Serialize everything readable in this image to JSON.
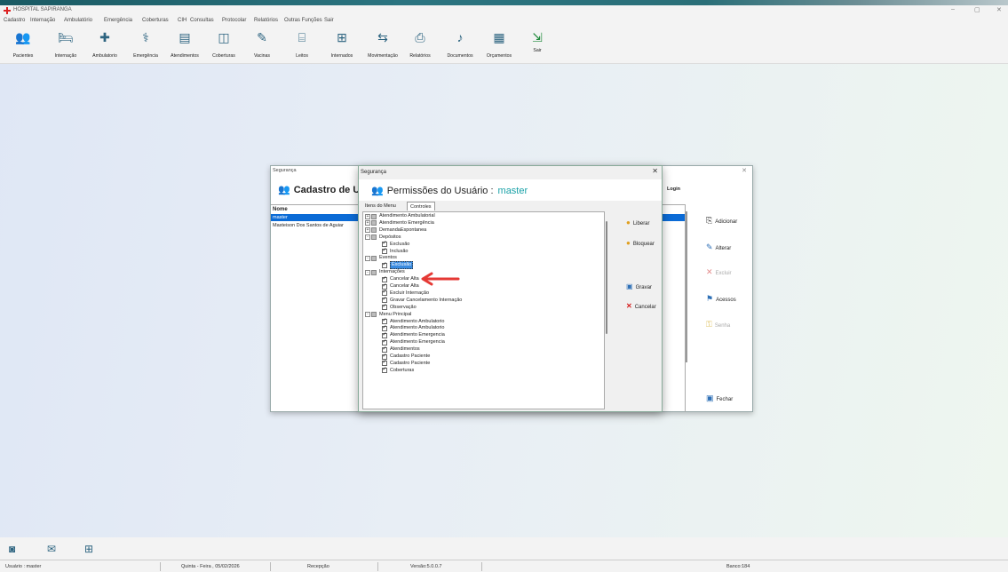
{
  "app": {
    "title": "HOSPITAL SAPIRANGA"
  },
  "menu": [
    "Cadastro",
    "Internação",
    "Ambulatório",
    "Emergência",
    "Coberturas",
    "CIH",
    "Consultas",
    "Protocolar",
    "Relatórios",
    "Outras Funções",
    "Sair"
  ],
  "toolbar": [
    {
      "label": "Pacientes",
      "icon": "patients-icon"
    },
    {
      "label": "Internação",
      "icon": "bed-icon"
    },
    {
      "label": "Ambulatorio",
      "icon": "medical-kit-icon"
    },
    {
      "label": "Emergência",
      "icon": "emergency-icon"
    },
    {
      "label": "Atendimentos",
      "icon": "clipboard-icon"
    },
    {
      "label": "Coberturas",
      "icon": "coverage-icon"
    },
    {
      "label": "Vacinas",
      "icon": "syringe-icon"
    },
    {
      "label": "Leitos",
      "icon": "beds-icon"
    },
    {
      "label": "Internados",
      "icon": "inpatients-icon"
    },
    {
      "label": "Movimentação",
      "icon": "movement-icon"
    },
    {
      "label": "Relatórios",
      "icon": "reports-icon"
    },
    {
      "label": "Documentos",
      "icon": "documents-icon"
    },
    {
      "label": "Orçamentos",
      "icon": "budget-icon"
    },
    {
      "label": "Sair",
      "icon": "exit-icon"
    }
  ],
  "cadastro": {
    "window_title": "Segurança",
    "heading": "Cadastro de U:",
    "col_nome": "Nome",
    "col_login": "Login",
    "rows": [
      "master",
      "Masteison Dos Santos de Aguiar"
    ],
    "buttons": [
      "Adicionar",
      "Alterar",
      "Excluir",
      "Acessos",
      "Senha",
      "Fechar"
    ]
  },
  "permissoes": {
    "window_title": "Segurança",
    "heading": "Permissões do Usuário :",
    "user": "master",
    "tabs": [
      "Itens do Menu",
      "Controles"
    ],
    "buttons": [
      "Liberar",
      "Bloquear",
      "Gravar",
      "Cancelar"
    ],
    "tree": [
      {
        "label": "Atendimento Ambulatorial",
        "level": 0,
        "expander": "+",
        "check": "part"
      },
      {
        "label": "Atendimento Emergência",
        "level": 0,
        "expander": "+",
        "check": "part"
      },
      {
        "label": "DemandaEspontanea",
        "level": 0,
        "expander": "+",
        "check": "part"
      },
      {
        "label": "Depósitos",
        "level": 0,
        "expander": "-",
        "check": "part"
      },
      {
        "label": "Exclusão",
        "level": 1,
        "check": "chk"
      },
      {
        "label": "Inclusão",
        "level": 1,
        "check": "chk"
      },
      {
        "label": "Eventos",
        "level": 0,
        "expander": "-",
        "check": "part"
      },
      {
        "label": "Exclusão",
        "level": 1,
        "check": "chk",
        "selected": true
      },
      {
        "label": "Internações",
        "level": 0,
        "expander": "-",
        "check": "part"
      },
      {
        "label": "Cancelar Alta",
        "level": 1,
        "check": "chk"
      },
      {
        "label": "Cancelar Alta",
        "level": 1,
        "check": "chk"
      },
      {
        "label": "Excluir Internação",
        "level": 1,
        "check": "chk"
      },
      {
        "label": "Gravar Cancelamento Internação",
        "level": 1,
        "check": "chk"
      },
      {
        "label": "Observação",
        "level": 1,
        "check": "chk"
      },
      {
        "label": "Menu Principal",
        "level": 0,
        "expander": "-",
        "check": "part"
      },
      {
        "label": "Atendimento Ambulatorio",
        "level": 1,
        "check": "chk"
      },
      {
        "label": "Atendimento Ambulatorio",
        "level": 1,
        "check": "chk"
      },
      {
        "label": "Atendimento Emergencia",
        "level": 1,
        "check": "chk"
      },
      {
        "label": "Atendimento Emergencia",
        "level": 1,
        "check": "chk"
      },
      {
        "label": "Atendimentos",
        "level": 1,
        "check": "chk"
      },
      {
        "label": "Cadastro Paciente",
        "level": 1,
        "check": "chk"
      },
      {
        "label": "Cadastro Paciente",
        "level": 1,
        "check": "chk"
      },
      {
        "label": "Coberturas",
        "level": 1,
        "check": "chk"
      }
    ]
  },
  "status": {
    "usuario": "Usuário : master",
    "data": "Quinta - Feira , 05/02/2026",
    "setor": "Recepção",
    "versao": "Versão:5.0.0.7",
    "banco": "Banco:184"
  },
  "colors": {
    "selection": "#0b6bd6",
    "accent_user": "#1aa2a8",
    "arrow": "#e53935"
  }
}
